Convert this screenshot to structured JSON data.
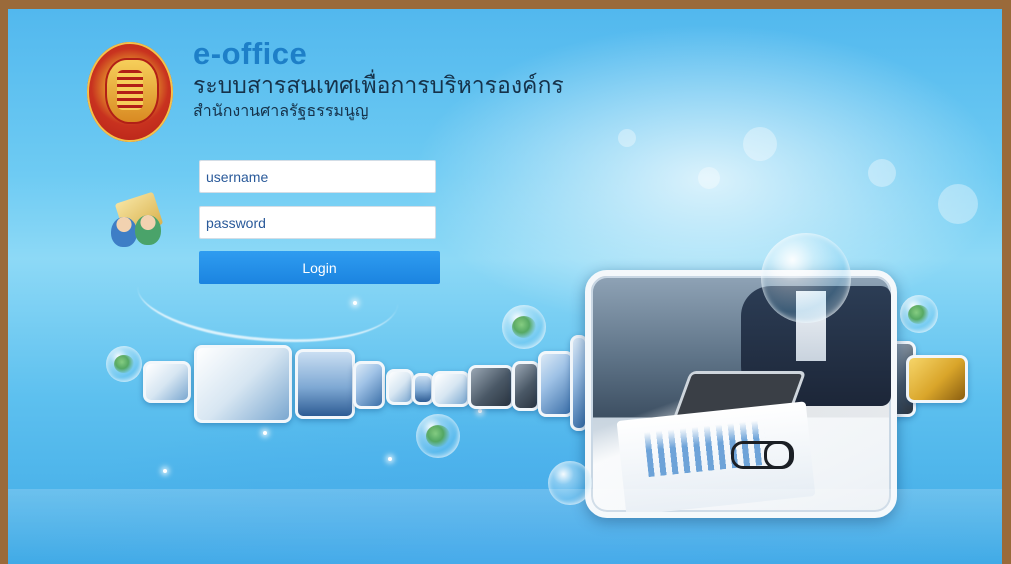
{
  "header": {
    "app_title": "e-office",
    "subtitle": "ระบบสารสนเทศเพื่อการบริหารองค์กร",
    "organization": "สำนักงานศาลรัฐธรรมนูญ"
  },
  "login_form": {
    "username": {
      "placeholder": "username",
      "value": ""
    },
    "password": {
      "placeholder": "password",
      "value": ""
    },
    "submit_label": "Login"
  },
  "icons": {
    "emblem": "court-emblem-icon",
    "users": "users-folder-icon"
  },
  "colors": {
    "accent": "#1d7fc8",
    "button": "#1b84e0",
    "frame_border": "#9a6a3a",
    "background": "#5dc0ef"
  }
}
